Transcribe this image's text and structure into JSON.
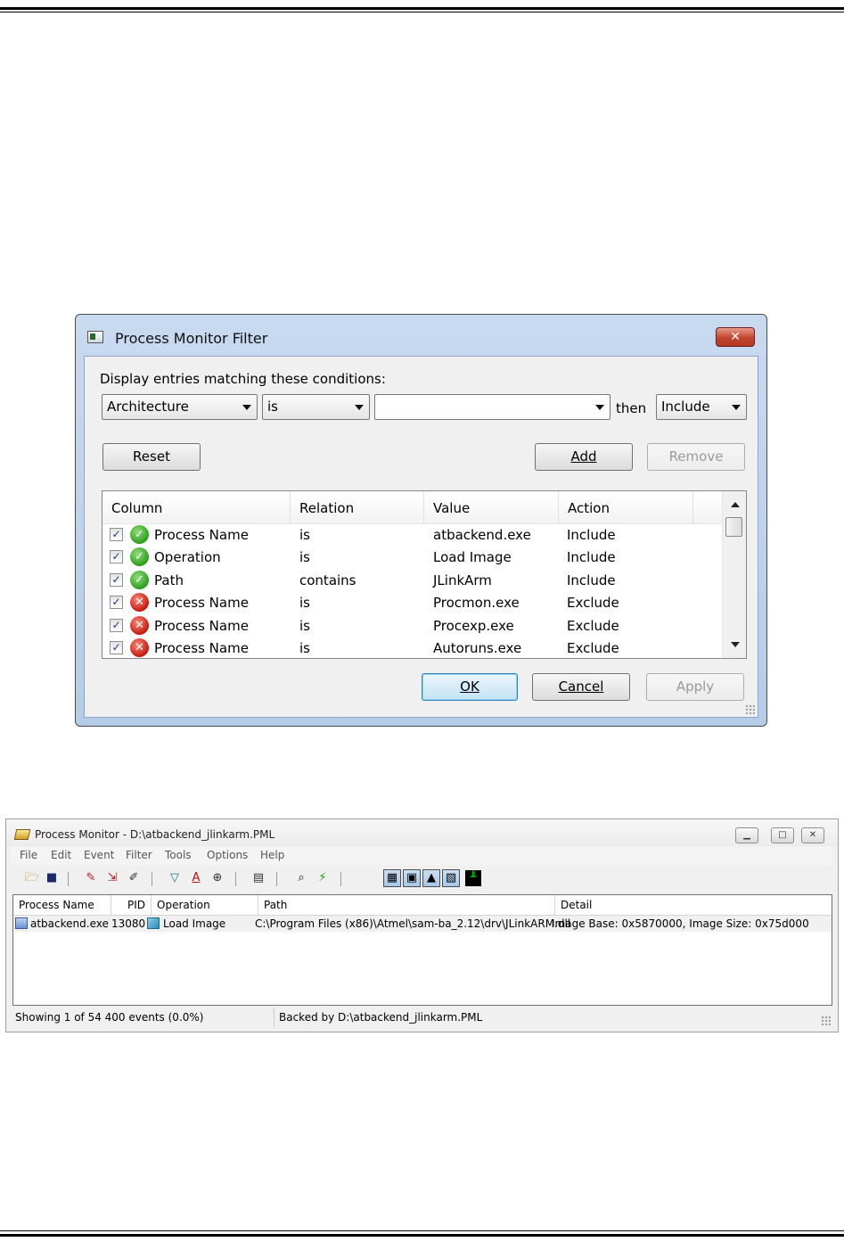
{
  "filter_dialog": {
    "title": "Process Monitor Filter",
    "close_label": "✕",
    "prompt": "Display entries matching these conditions:",
    "column_select": "Architecture",
    "relation_select": "is",
    "value_input": "",
    "then_label": "then",
    "action_select": "Include",
    "buttons": {
      "reset": "Reset",
      "add": "Add",
      "remove": "Remove",
      "ok": "OK",
      "cancel": "Cancel",
      "apply": "Apply"
    },
    "list": {
      "headers": [
        "Column",
        "Relation",
        "Value",
        "Action"
      ],
      "rows": [
        {
          "checked": true,
          "status": "include",
          "column": "Process Name",
          "relation": "is",
          "value": "atbackend.exe",
          "action": "Include"
        },
        {
          "checked": true,
          "status": "include",
          "column": "Operation",
          "relation": "is",
          "value": "Load Image",
          "action": "Include"
        },
        {
          "checked": true,
          "status": "include",
          "column": "Path",
          "relation": "contains",
          "value": "JLinkArm",
          "action": "Include"
        },
        {
          "checked": true,
          "status": "exclude",
          "column": "Process Name",
          "relation": "is",
          "value": "Procmon.exe",
          "action": "Exclude"
        },
        {
          "checked": true,
          "status": "exclude",
          "column": "Process Name",
          "relation": "is",
          "value": "Procexp.exe",
          "action": "Exclude"
        },
        {
          "checked": true,
          "status": "exclude",
          "column": "Process Name",
          "relation": "is",
          "value": "Autoruns.exe",
          "action": "Exclude"
        }
      ]
    }
  },
  "procmon": {
    "title": "Process Monitor - D:\\atbackend_jlinkarm.PML",
    "menu": [
      "File",
      "Edit",
      "Event",
      "Filter",
      "Tools",
      "Options",
      "Help"
    ],
    "columns": [
      "Process Name",
      "PID",
      "Operation",
      "Path",
      "Detail"
    ],
    "rows": [
      {
        "process": "atbackend.exe",
        "pid": "13080",
        "operation": "Load Image",
        "path": "C:\\Program Files (x86)\\Atmel\\sam-ba_2.12\\drv\\JLinkARM.dll",
        "detail": "Image Base: 0x5870000, Image Size: 0x75d000"
      }
    ],
    "status": {
      "events": "Showing 1 of 54 400 events (0.0%)",
      "backing": "Backed by D:\\atbackend_jlinkarm.PML"
    }
  }
}
